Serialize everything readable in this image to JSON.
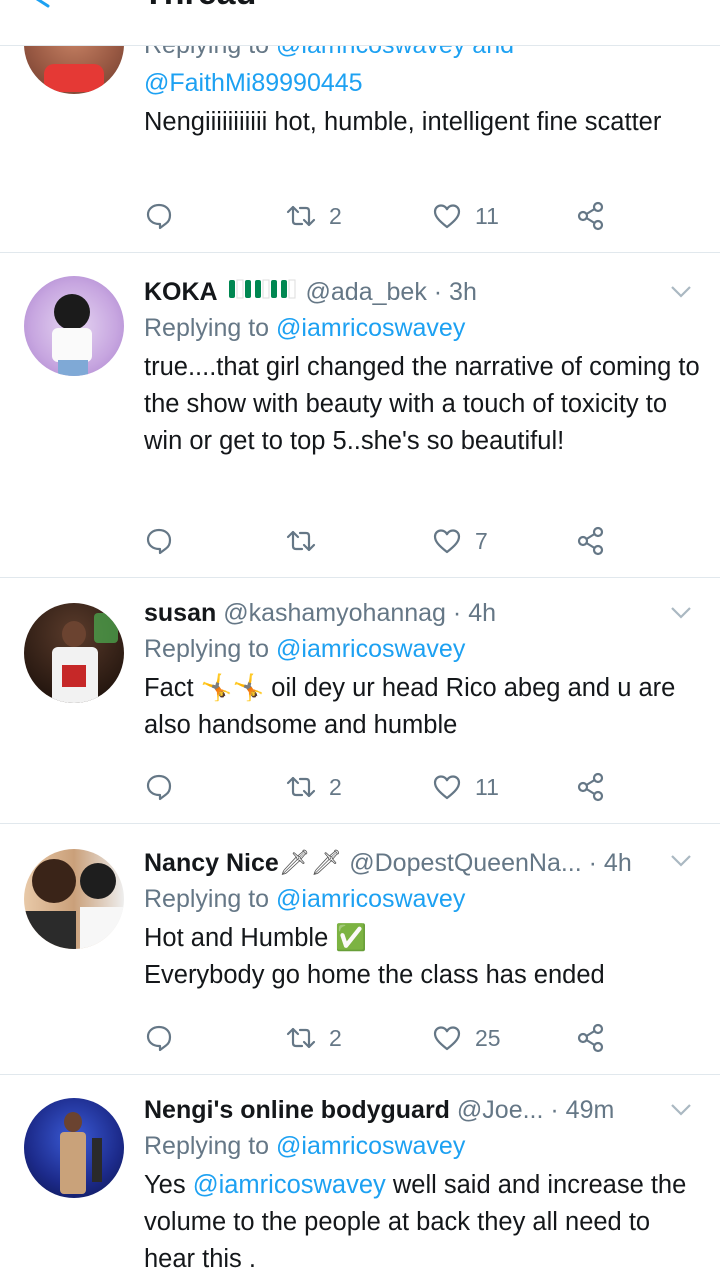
{
  "header": {
    "title": "Thread"
  },
  "tweets": [
    {
      "name": "",
      "handle": "",
      "time": "",
      "replying_prefix": "Replying to",
      "replying_to": "@iamricoswavey and",
      "replying_to_2": "@FaithMi89990445",
      "body": "Nengiiiiiiiiiii hot, humble, intelligent fine scatter",
      "retweets": "2",
      "likes": "11"
    },
    {
      "name": "KOKA",
      "handle": "@ada_bek",
      "time": "· 3h",
      "replying_prefix": "Replying to",
      "replying_to": "@iamricoswavey",
      "body": "true....that girl changed the narrative of coming to the show with beauty with a touch of toxicity to win or get to top 5..she's so beautiful!",
      "retweets": "",
      "likes": "7"
    },
    {
      "name": "susan",
      "handle": "@kashamyohannag",
      "time": "· 4h",
      "replying_prefix": "Replying to",
      "replying_to": "@iamricoswavey",
      "body_before": "Fact",
      "body_emoji": "🤸🤸",
      "body_after": " oil dey ur head Rico abeg and u are also handsome and humble",
      "retweets": "2",
      "likes": "11"
    },
    {
      "name": "Nancy Nice",
      "name_emoji": "🗡🗡",
      "handle": "@DopestQueenNa...",
      "time": "· 4h",
      "replying_prefix": "Replying to",
      "replying_to": "@iamricoswavey",
      "body_line1": "Hot and Humble ✅",
      "body_line2": "Everybody go home the class has ended",
      "retweets": "2",
      "likes": "25"
    },
    {
      "name": "Nengi's online bodyguard",
      "handle": "@Joe...",
      "time": "· 49m",
      "replying_prefix": "Replying to",
      "replying_to": "@iamricoswavey",
      "body_mention": "@iamricoswavey",
      "body_prefix": "Yes ",
      "body_after": " well said and increase the volume to the people at back they all need to hear this ."
    }
  ],
  "colors": {
    "accent": "#1da1f2",
    "muted": "#657786",
    "text": "#14171a",
    "divider": "#e1e8ed",
    "flag_green": "#008751"
  },
  "icons": [
    "back-arrow-icon",
    "reply-icon",
    "retweet-icon",
    "like-icon",
    "share-icon",
    "chevron-down-icon"
  ]
}
